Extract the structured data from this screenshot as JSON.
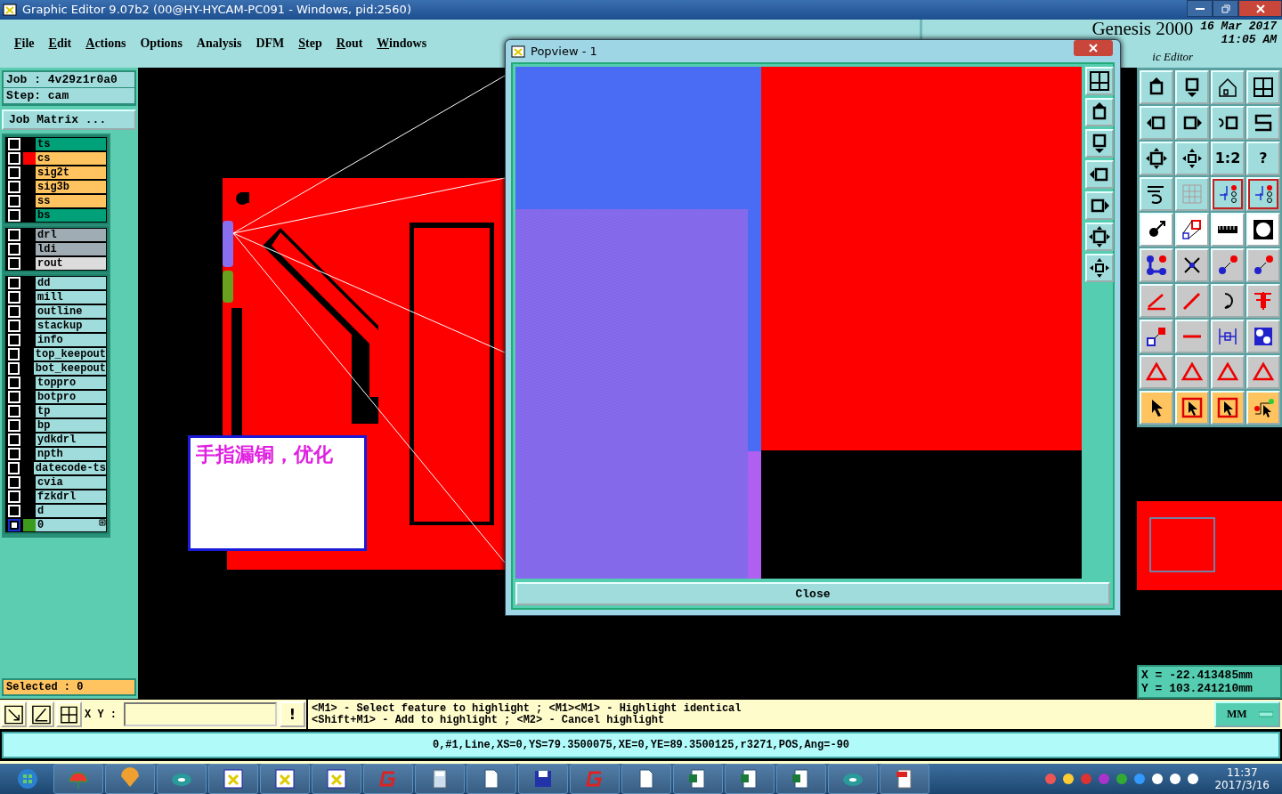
{
  "window": {
    "title": "Graphic Editor 9.07b2 (00@HY-HYCAM-PC091 - Windows, pid:2560)"
  },
  "menu": [
    {
      "label": "File",
      "underline_first": true
    },
    {
      "label": "Edit",
      "underline_first": true
    },
    {
      "label": "Actions",
      "underline_first": true
    },
    {
      "label": "Options",
      "underline_first": false
    },
    {
      "label": "Analysis",
      "underline_first": false
    },
    {
      "label": "DFM",
      "underline_first": false
    },
    {
      "label": "Step",
      "underline_first": true
    },
    {
      "label": "Rout",
      "underline_first": true
    },
    {
      "label": "Windows",
      "underline_first": true
    }
  ],
  "header": {
    "product": "Genesis 2000",
    "subtitle": "ic Editor",
    "date": "16 Mar 2017",
    "time": "11:05 AM"
  },
  "job": {
    "job": "Job : 4v29z1r0a0",
    "step": "Step: cam",
    "matrix_button": "Job Matrix ..."
  },
  "layer_groups": [
    {
      "layers": [
        {
          "name": "ts",
          "kind": "mask",
          "selected": false
        },
        {
          "name": "cs",
          "kind": "signal",
          "color": "#ff0000",
          "selected": false
        },
        {
          "name": "sig2t",
          "kind": "signal",
          "selected": false
        },
        {
          "name": "sig3b",
          "kind": "signal",
          "selected": false
        },
        {
          "name": "ss",
          "kind": "signal",
          "selected": false
        },
        {
          "name": "bs",
          "kind": "mask",
          "selected": false
        }
      ]
    },
    {
      "layers": [
        {
          "name": "drl",
          "kind": "drill",
          "selected": false
        },
        {
          "name": "ldi",
          "kind": "drill",
          "selected": false
        },
        {
          "name": "rout",
          "kind": "rout",
          "selected": false
        }
      ]
    },
    {
      "layers": [
        {
          "name": "dd",
          "kind": "document",
          "selected": false
        },
        {
          "name": "mill",
          "kind": "document",
          "selected": false
        },
        {
          "name": "outline",
          "kind": "document",
          "selected": false
        },
        {
          "name": "stackup",
          "kind": "document",
          "selected": false
        },
        {
          "name": "info",
          "kind": "document",
          "selected": false
        },
        {
          "name": "top_keepout",
          "kind": "document",
          "selected": false
        },
        {
          "name": "bot_keepout",
          "kind": "document",
          "selected": false
        },
        {
          "name": "toppro",
          "kind": "document",
          "selected": false
        },
        {
          "name": "botpro",
          "kind": "document",
          "selected": false
        },
        {
          "name": "tp",
          "kind": "document",
          "selected": false
        },
        {
          "name": "bp",
          "kind": "document",
          "selected": false
        },
        {
          "name": "ydkdrl",
          "kind": "document",
          "selected": false
        },
        {
          "name": "npth",
          "kind": "document",
          "selected": false
        },
        {
          "name": "datecode-ts",
          "kind": "document",
          "selected": false
        },
        {
          "name": "cvia",
          "kind": "document",
          "selected": false
        },
        {
          "name": "fzkdrl",
          "kind": "document",
          "selected": false
        },
        {
          "name": "d",
          "kind": "document",
          "selected": false
        },
        {
          "name": "0",
          "kind": "document",
          "color": "#3c9a1c",
          "selected": true
        }
      ]
    }
  ],
  "selected_count": "Selected : 0",
  "note": "手指漏铜，优化",
  "toolbar": {
    "ratio_label": "1:2",
    "help_label": "?"
  },
  "popview": {
    "title": "Popview - 1",
    "close_button": "Close"
  },
  "coordinates": {
    "x": "X = -22.413485mm",
    "y": "Y = 103.241210mm"
  },
  "command": {
    "xy_label": "X Y :",
    "alert_button": "!",
    "hints": [
      "<M1> - Select feature to highlight ; <M1><M1> - Highlight identical",
      "<Shift+M1> - Add to highlight ; <M2> - Cancel highlight"
    ],
    "units": "MM"
  },
  "status_line": "0,#1,Line,XS=0,YS=79.3500075,XE=0,YE=89.3500125,r3271,POS,Ang=-90",
  "taskbar": {
    "time": "11:37",
    "date": "2017/3/16"
  }
}
